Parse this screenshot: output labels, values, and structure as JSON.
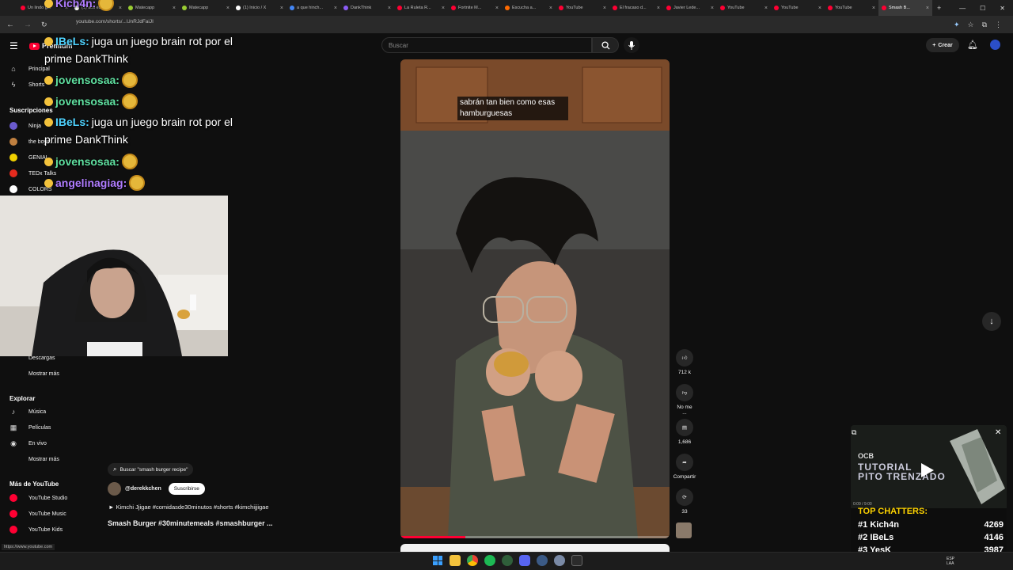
{
  "browser": {
    "tabs": [
      {
        "title": "Un lindo g...",
        "color": "#ff0033"
      },
      {
        "title": "(1) aca est...",
        "color": "#ffffff"
      },
      {
        "title": "Matecapp",
        "color": "#9acd32"
      },
      {
        "title": "Matecapp",
        "color": "#9acd32"
      },
      {
        "title": "(1) Inicio / X",
        "color": "#ffffff"
      },
      {
        "title": "a que hinch...",
        "color": "#4285f4"
      },
      {
        "title": "DankThink",
        "color": "#8a5cf5"
      },
      {
        "title": "La Ruleta R...",
        "color": "#ff0033"
      },
      {
        "title": "Fortnite M...",
        "color": "#ff0033"
      },
      {
        "title": "Escucha a...",
        "color": "#ff6a00"
      },
      {
        "title": "YouTube",
        "color": "#ff0033"
      },
      {
        "title": "El fracaso d...",
        "color": "#ff0033"
      },
      {
        "title": "Javier Lede...",
        "color": "#ff0033"
      },
      {
        "title": "YouTube",
        "color": "#ff0033"
      },
      {
        "title": "YouTube",
        "color": "#ff0033"
      },
      {
        "title": "YouTube",
        "color": "#ff0033"
      },
      {
        "title": "Smash B...",
        "color": "#ff0033"
      }
    ],
    "url": "youtube.com/shorts/...UnRJdFaiJI",
    "status_url": "https://www.youtube.com"
  },
  "youtube": {
    "premium_label": "Premium",
    "search_placeholder": "Buscar",
    "create_label": "Crear",
    "sidebar": {
      "main": [
        {
          "label": "Principal",
          "icon": "home-icon"
        },
        {
          "label": "Shorts",
          "icon": "shorts-icon"
        }
      ],
      "subs_heading": "Suscripciones",
      "subs": [
        {
          "label": "Ninja",
          "color": "#6a5acd"
        },
        {
          "label": "the boys...",
          "color": "#c08040"
        },
        {
          "label": "GENIAL",
          "color": "#f0d000"
        },
        {
          "label": "TEDx Talks",
          "color": "#e62b1e"
        },
        {
          "label": "COLORS",
          "color": "#ffffff"
        }
      ],
      "downloads": "Descargas",
      "show_more": "Mostrar más",
      "explore_heading": "Explorar",
      "explore": [
        {
          "label": "Música",
          "icon": "music-icon"
        },
        {
          "label": "Películas",
          "icon": "movies-icon"
        },
        {
          "label": "En vivo",
          "icon": "live-icon"
        }
      ],
      "show_more2": "Mostrar más",
      "more_heading": "Más de YouTube",
      "more": [
        {
          "label": "YouTube Studio"
        },
        {
          "label": "YouTube Music"
        },
        {
          "label": "YouTube Kids"
        }
      ]
    },
    "short": {
      "caption": "sabrán tan bien como esas hamburguesas",
      "search_chip": "Buscar \"smash burger recipe\"",
      "channel": "@derekkchen",
      "subscribe": "Suscribirse",
      "music": "► Kimchi Jjigae #comidasde30minutos #shorts #kimchijjigae",
      "title": "Smash Burger #30minutemeals #smashburger ...",
      "likes": "712 k",
      "dislike": "No me ...",
      "comments": "1,686",
      "share": "Compartir",
      "remix": "33",
      "progress": 0.24
    }
  },
  "chat": {
    "lines": [
      {
        "user": "Kich4n:",
        "text": "",
        "color": "#b07cff"
      },
      {
        "user": "IBeLs:",
        "text": "juga un juego brain rot por el",
        "color": "#4fd3ff"
      },
      {
        "user": "",
        "text": "prime DankThink",
        "color": "#ffffff"
      },
      {
        "user": "jovensosaa:",
        "text": "",
        "color": "#5fe0a0"
      },
      {
        "user": "jovensosaa:",
        "text": "",
        "color": "#5fe0a0"
      },
      {
        "user": "IBeLs:",
        "text": "juga un juego brain rot por el",
        "color": "#4fd3ff"
      },
      {
        "user": "",
        "text": "prime DankThink",
        "color": "#ffffff"
      },
      {
        "user": "jovensosaa:",
        "text": "",
        "color": "#5fe0a0"
      },
      {
        "user": "angelinagiag:",
        "text": "",
        "color": "#b07cff"
      }
    ]
  },
  "miniplayer": {
    "brand": "OCB",
    "title_line1": "TUTORIAL",
    "title_line2": "PITO TRENZADO",
    "time": "0:09 / 9:00"
  },
  "chatters": {
    "heading": "TOP CHATTERS:",
    "rows": [
      {
        "rank": "#1",
        "name": "Kich4n",
        "count": "4269"
      },
      {
        "rank": "#2",
        "name": "IBeLs",
        "count": "4146"
      },
      {
        "rank": "#3",
        "name": "YesK",
        "count": "3987"
      }
    ]
  },
  "taskbar": {
    "lang": "ESP LAA"
  },
  "colors": {
    "accent": "#ff0033",
    "chatters_heading": "#ffd400"
  }
}
